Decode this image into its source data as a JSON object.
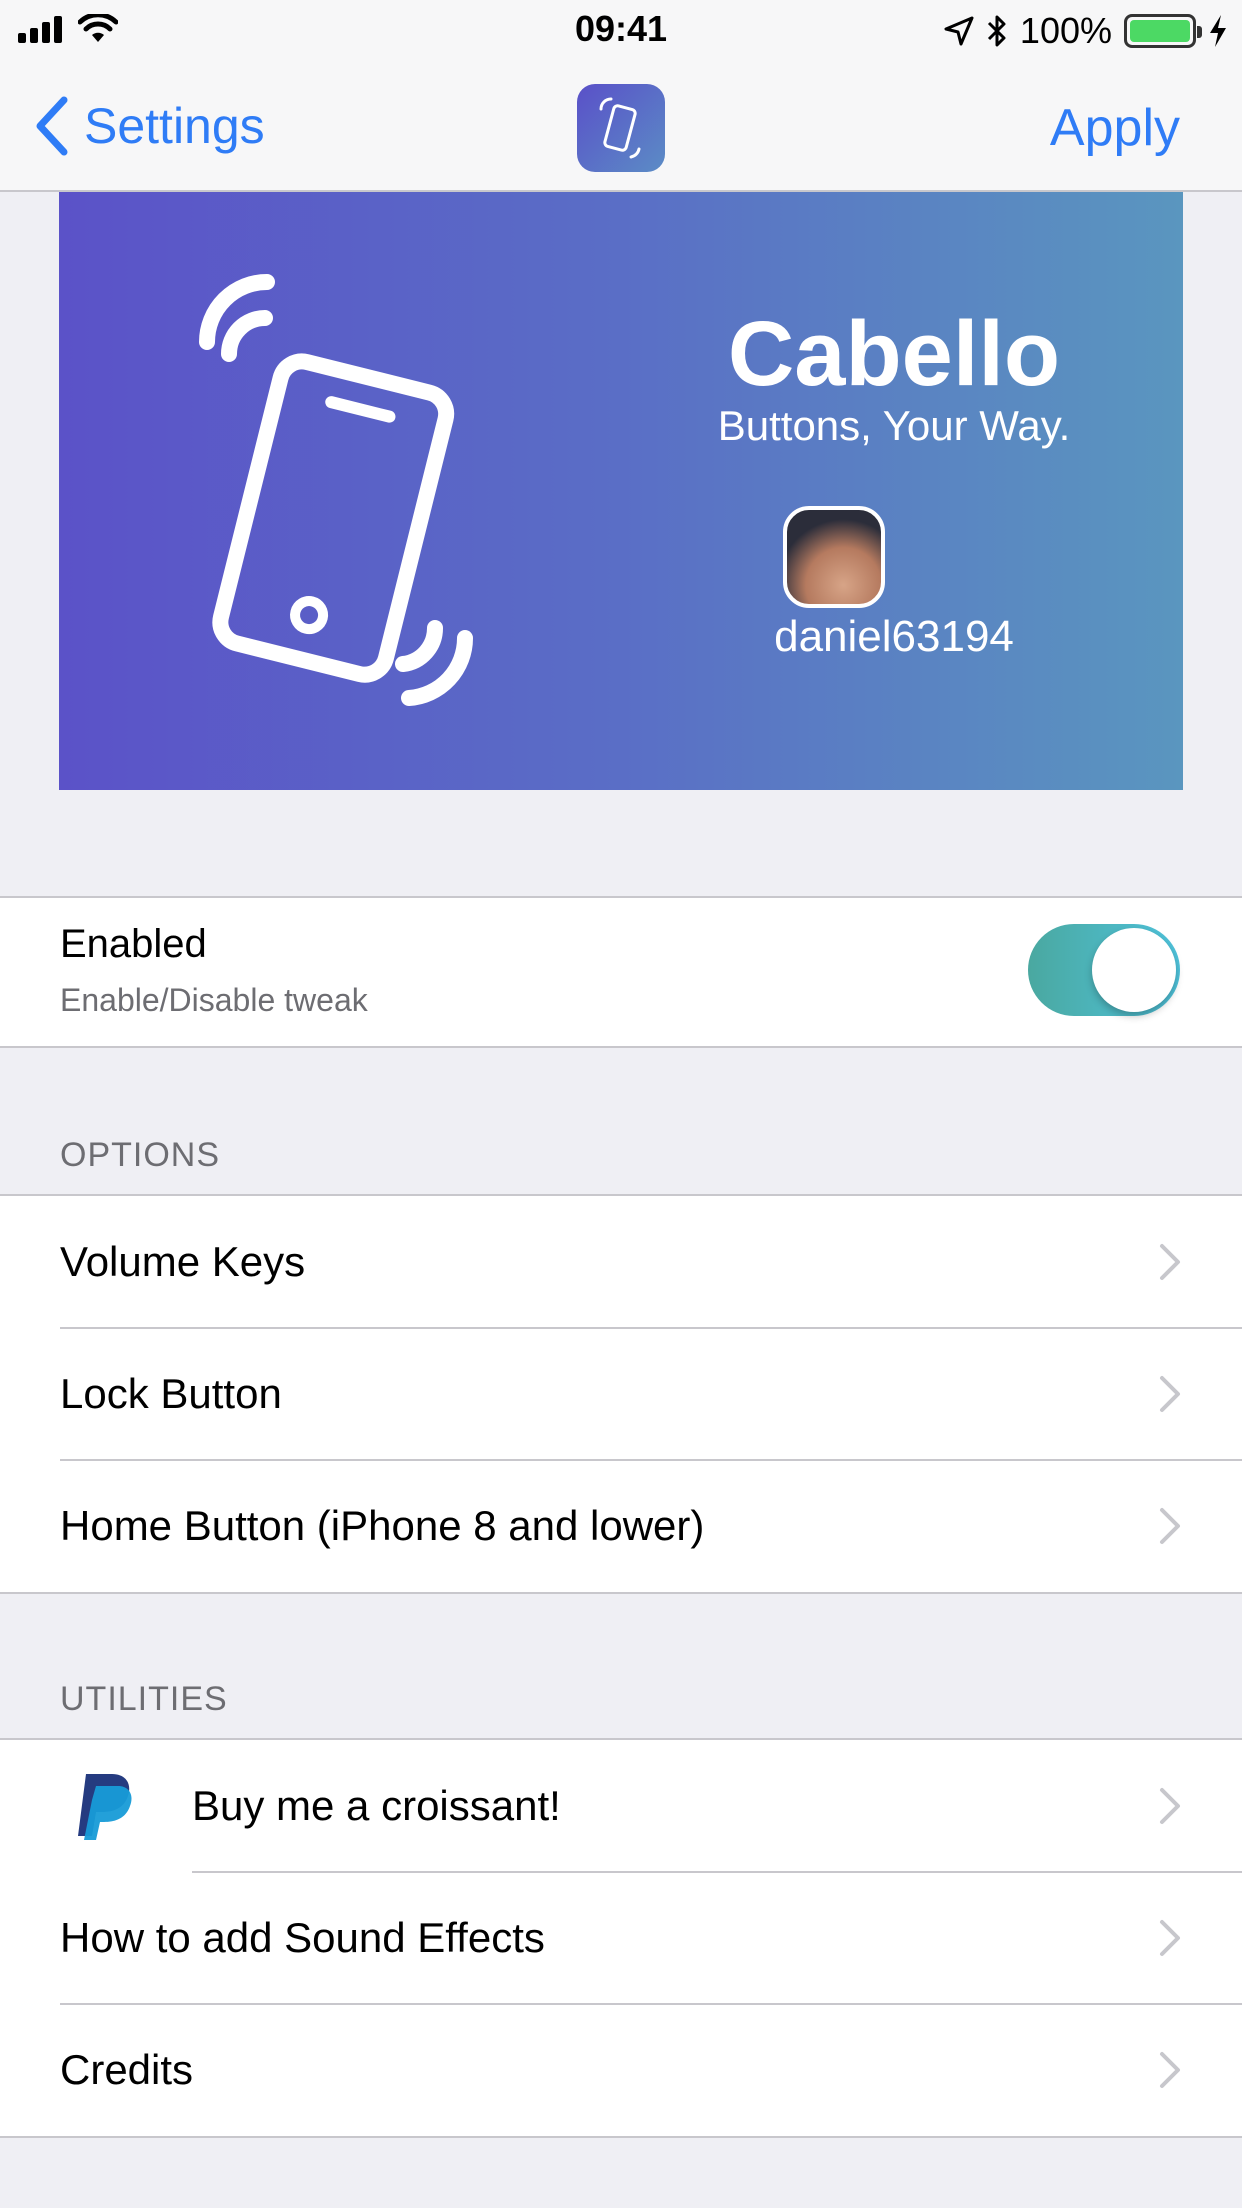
{
  "status_bar": {
    "time": "09:41",
    "battery": "100%"
  },
  "nav": {
    "back_label": "Settings",
    "apply_label": "Apply"
  },
  "banner": {
    "title": "Cabello",
    "subtitle": "Buttons, Your Way.",
    "author": "daniel63194"
  },
  "enabled": {
    "label": "Enabled",
    "sublabel": "Enable/Disable tweak",
    "on": true
  },
  "options": {
    "header": "OPTIONS",
    "items": [
      {
        "label": "Volume Keys"
      },
      {
        "label": "Lock Button"
      },
      {
        "label": "Home Button (iPhone 8 and lower)"
      }
    ]
  },
  "utilities": {
    "header": "UTILITIES",
    "items": [
      {
        "label": "Buy me a croissant!",
        "icon": "paypal-icon"
      },
      {
        "label": "How to add Sound Effects"
      },
      {
        "label": "Credits"
      }
    ]
  },
  "colors": {
    "accent": "#2f7cf6",
    "toggle_on": "#4fc3dc",
    "banner_start": "#5b52c8",
    "banner_end": "#5a96bf"
  }
}
